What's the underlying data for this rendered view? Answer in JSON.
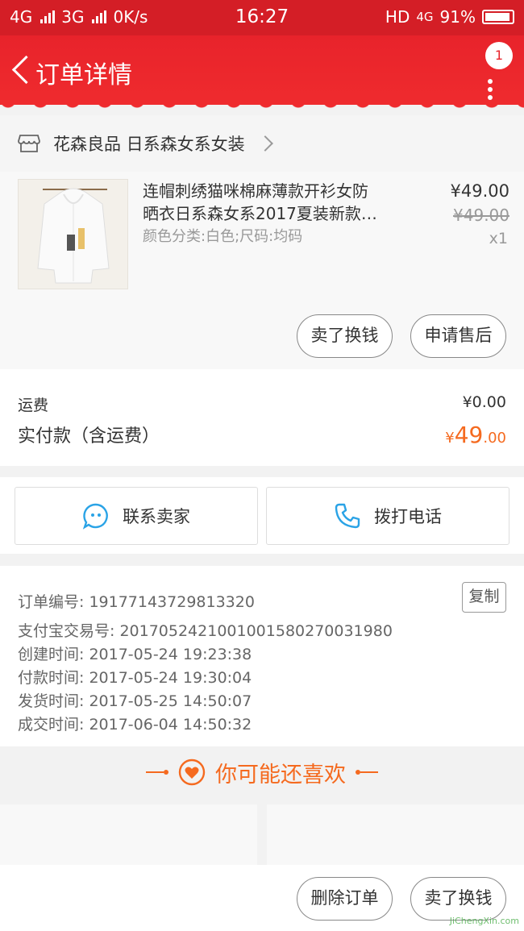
{
  "status_bar": {
    "left_items": [
      "4G",
      "3G",
      "0K/s"
    ],
    "time": "16:27",
    "network": "HD",
    "network2": "4G",
    "battery": "91%"
  },
  "header": {
    "title": "订单详情",
    "badge_count": "1"
  },
  "store": {
    "name": "花森良品 日系森女系女装"
  },
  "product": {
    "name_line1": "连帽刺绣猫咪棉麻薄款开衫女防",
    "name_line2": "晒衣日系森女系2017夏装新款…",
    "attributes": "颜色分类:白色;尺码:均码",
    "price": "¥49.00",
    "original_price": "¥49.00",
    "quantity": "x1",
    "sell_button": "卖了换钱",
    "after_sale_button": "申请售后"
  },
  "fees": {
    "shipping_label": "运费",
    "shipping_value": "¥0.00",
    "paid_label": "实付款（含运费）",
    "paid_currency": "¥",
    "paid_integer": "49",
    "paid_decimal": ".00"
  },
  "contact": {
    "seller_label": "联系卖家",
    "phone_label": "拨打电话"
  },
  "order_info": {
    "order_no": "订单编号: 19177143729813320",
    "copy_label": "复制",
    "alipay_no": "支付宝交易号: 2017052421001001580270031980",
    "created": "创建时间: 2017-05-24 19:23:38",
    "paid": "付款时间: 2017-05-24 19:30:04",
    "shipped": "发货时间: 2017-05-25 14:50:07",
    "completed": "成交时间: 2017-06-04 14:50:32"
  },
  "recommend": {
    "title": "你可能还喜欢"
  },
  "bottom_bar": {
    "delete_label": "删除订单",
    "sell_label": "卖了换钱"
  },
  "watermark": "JiChengXin.com",
  "colors": {
    "header_red": "#e8232b",
    "accent_orange": "#f56a1f"
  },
  "icons": [
    "back-arrow-icon",
    "more-dots-icon",
    "store-icon",
    "chevron-right-icon",
    "chat-bubble-icon",
    "phone-icon",
    "heart-icon"
  ]
}
